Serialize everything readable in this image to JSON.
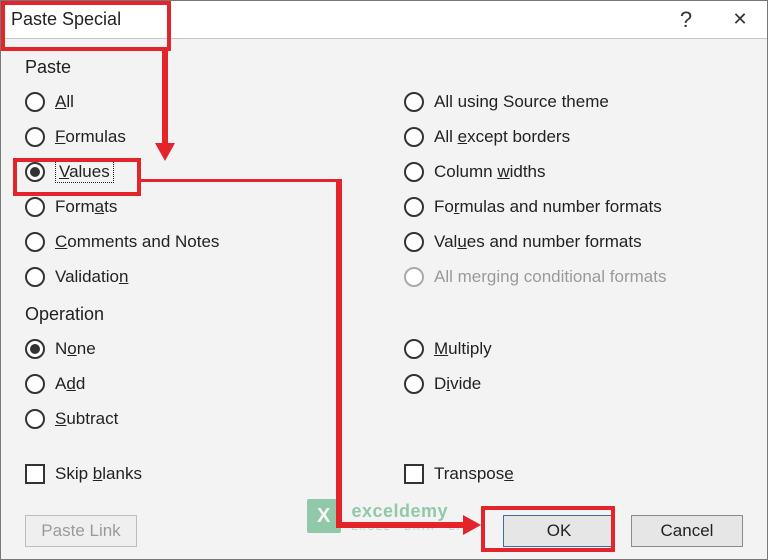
{
  "window": {
    "title": "Paste Special",
    "help": "?",
    "close": "✕"
  },
  "groups": {
    "paste": "Paste",
    "operation": "Operation"
  },
  "paste_left": [
    {
      "label": "All",
      "u": 0
    },
    {
      "label": "Formulas",
      "u": 0
    },
    {
      "label": "Values",
      "u": 0
    },
    {
      "label": "Formats",
      "u": 4
    },
    {
      "label": "Comments and Notes",
      "u": 0
    },
    {
      "label": "Validation",
      "u": 9
    }
  ],
  "paste_right": [
    {
      "label": "All using Source theme",
      "u": -1
    },
    {
      "label": "All except borders",
      "u": 4
    },
    {
      "label": "Column widths",
      "u": 7
    },
    {
      "label": "Formulas and number formats",
      "u": 2
    },
    {
      "label": "Values and number formats",
      "u": 3
    },
    {
      "label": "All merging conditional formats",
      "u": -1,
      "disabled": true
    }
  ],
  "op_left": [
    {
      "label": "None",
      "u": 1
    },
    {
      "label": "Add",
      "u": 1
    },
    {
      "label": "Subtract",
      "u": 0
    }
  ],
  "op_right": [
    {
      "label": "Multiply",
      "u": 0
    },
    {
      "label": "Divide",
      "u": 1
    }
  ],
  "skip_blanks": "Skip blanks",
  "transpose": "Transpose",
  "buttons": {
    "paste_link": "Paste Link",
    "ok": "OK",
    "cancel": "Cancel"
  },
  "selected_paste": "Values",
  "selected_op": "None",
  "watermark": {
    "brand": "exceldemy",
    "sub": "EXCEL · DATA · BI"
  }
}
